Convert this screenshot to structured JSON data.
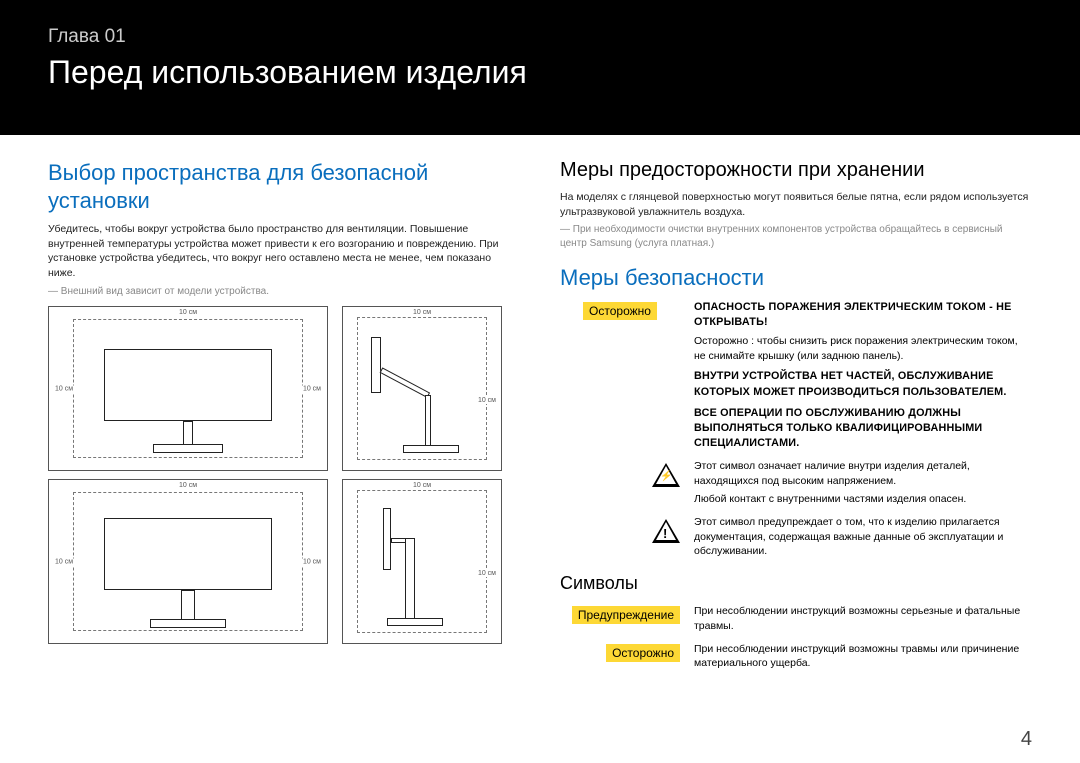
{
  "header": {
    "chapter_label": "Глава 01",
    "chapter_title": "Перед использованием изделия"
  },
  "left": {
    "heading": "Выбор пространства для безопасной установки",
    "p1": "Убедитесь, чтобы вокруг устройства было пространство для вентиляции. Повышение внутренней температуры устройства может привести к его возгоранию и повреждению. При установке устройства убедитесь, что вокруг него оставлено места не менее, чем показано ниже.",
    "note": "Внешний вид зависит от модели устройства.",
    "dim": "10 см"
  },
  "right": {
    "storage_heading": "Меры предосторожности при хранении",
    "storage_p": "На моделях с глянцевой поверхностью могут появиться белые пятна, если рядом используется ультразвуковой увлажнитель воздуха.",
    "storage_note": "При необходимости очистки внутренних компонентов устройства обращайтесь в сервисный центр Samsung (услуга платная.)",
    "safety_heading": "Меры безопасности",
    "caution_label": "Осторожно",
    "warning_label": "Предупреждение",
    "caution_block": {
      "line1": "ОПАСНОСТЬ ПОРАЖЕНИЯ ЭЛЕКТРИЧЕСКИМ ТОКОМ - НЕ ОТКРЫВАТЬ!",
      "line2": "Осторожно : чтобы снизить риск поражения электрическим током, не снимайте крышку (или заднюю панель).",
      "line3": "ВНУТРИ УСТРОЙСТВА НЕТ ЧАСТЕЙ, ОБСЛУЖИВАНИЕ КОТОРЫХ МОЖЕТ ПРОИЗВОДИТЬСЯ ПОЛЬЗОВАТЕЛЕМ.",
      "line4": "ВСЕ ОПЕРАЦИИ ПО ОБСЛУЖИВАНИЮ ДОЛЖНЫ ВЫПОЛНЯТЬСЯ ТОЛЬКО КВАЛИФИЦИРОВАННЫМИ СПЕЦИАЛИСТАМИ."
    },
    "tri_bolt_text1": "Этот символ означает наличие внутри изделия деталей, находящихся под высоким напряжением.",
    "tri_bolt_text2": "Любой контакт с внутренними частями изделия опасен.",
    "tri_excl_text": "Этот символ предупреждает о том, что к изделию прилагается документация, содержащая важные данные об эксплуатации и обслуживании.",
    "symbols_heading": "Символы",
    "warning_text": "При несоблюдении инструкций возможны серьезные и фатальные травмы.",
    "caution_text": "При несоблюдении инструкций возможны травмы или причинение материального ущерба."
  },
  "page_number": "4"
}
